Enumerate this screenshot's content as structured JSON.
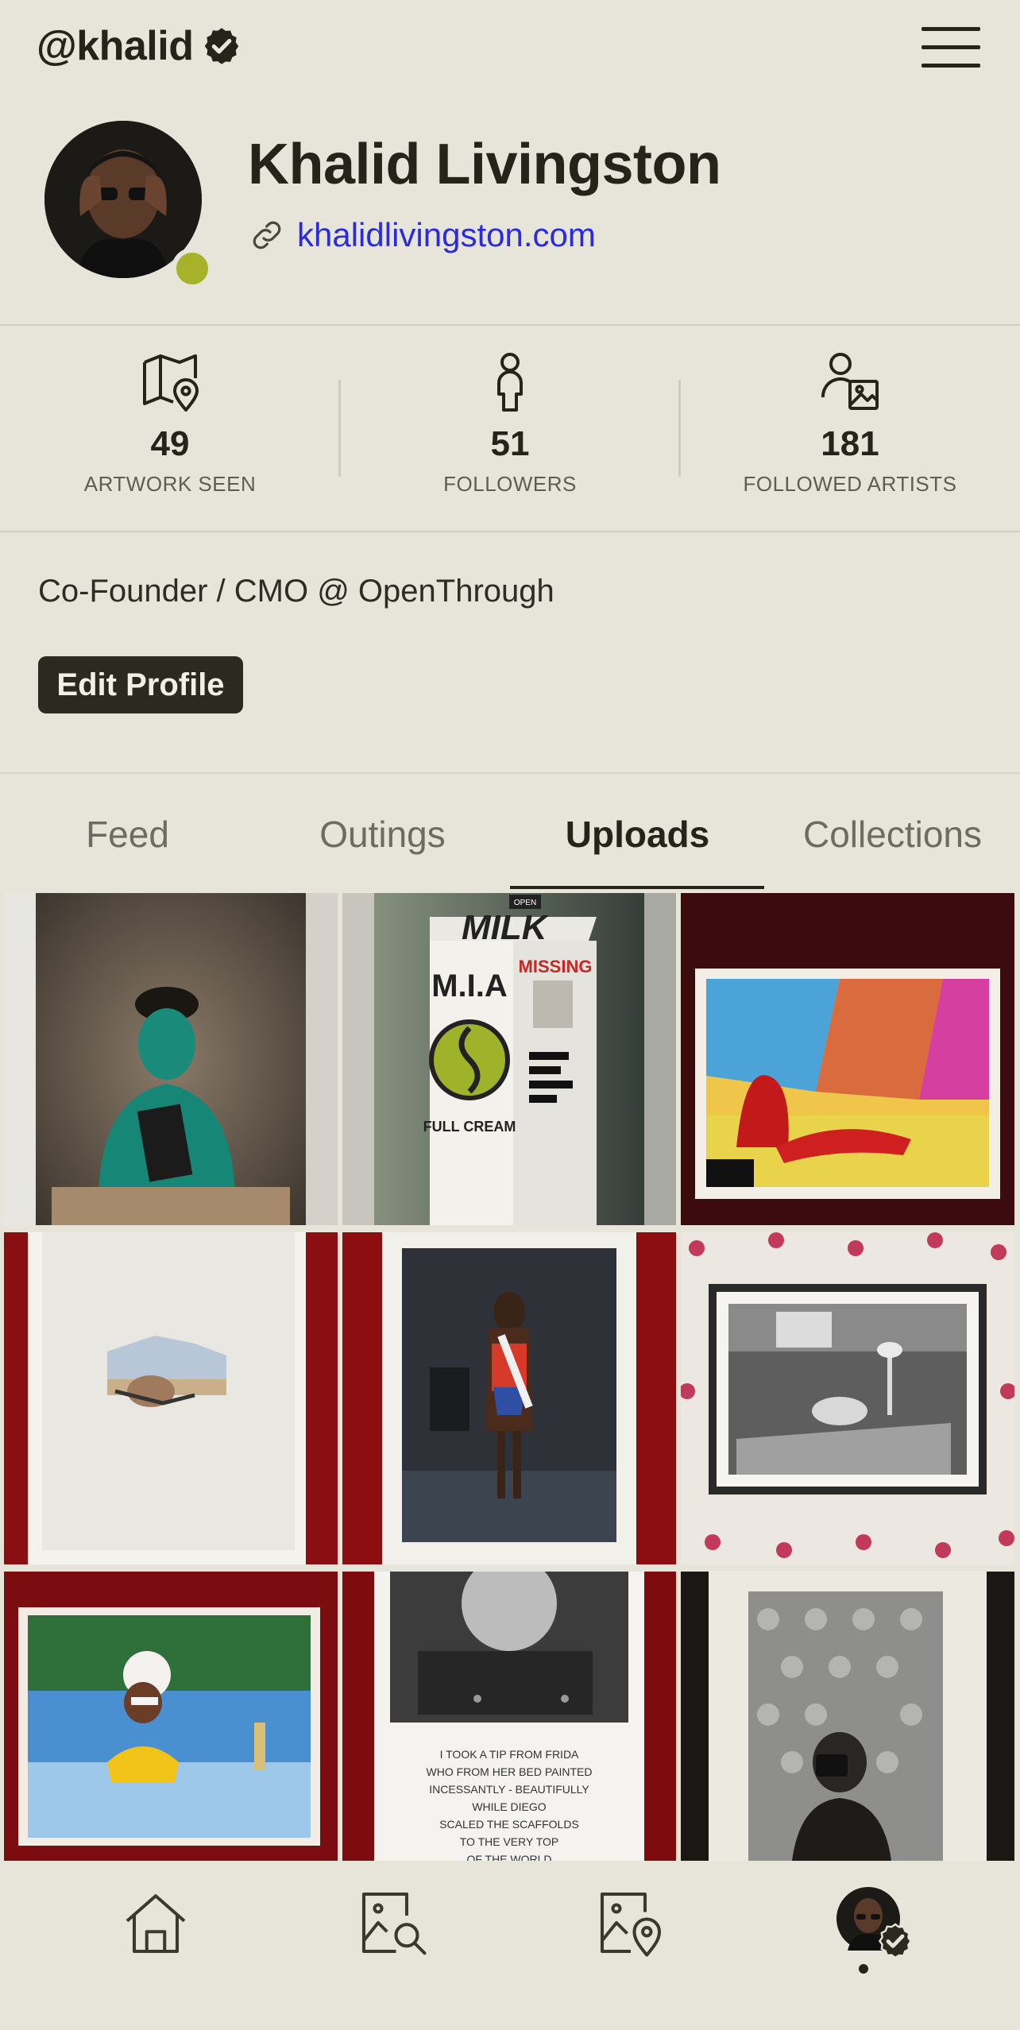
{
  "header": {
    "handle": "@khalid",
    "verified_icon": "verified-badge-icon",
    "menu_icon": "hamburger-menu-icon"
  },
  "profile": {
    "name": "Khalid Livingston",
    "website": "khalidlivingston.com",
    "link_icon": "link-icon",
    "status_color": "#a8b12a"
  },
  "stats": [
    {
      "icon": "map-pin-icon",
      "value": "49",
      "label": "ARTWORK SEEN"
    },
    {
      "icon": "person-icon",
      "value": "51",
      "label": "FOLLOWERS"
    },
    {
      "icon": "person-image-icon",
      "value": "181",
      "label": "FOLLOWED ARTISTS"
    }
  ],
  "bio": "Co-Founder / CMO @ OpenThrough",
  "edit_profile_label": "Edit Profile",
  "tabs": [
    {
      "label": "Feed",
      "active": false
    },
    {
      "label": "Outings",
      "active": false
    },
    {
      "label": "Uploads",
      "active": true
    },
    {
      "label": "Collections",
      "active": false
    }
  ],
  "uploads": [
    {
      "artwork_text": []
    },
    {
      "artwork_text": [
        "MILK",
        "M.I.A",
        "MISSING",
        "FULL CREAM",
        "OPEN"
      ]
    },
    {
      "artwork_text": []
    },
    {
      "artwork_text": []
    },
    {
      "artwork_text": []
    },
    {
      "artwork_text": []
    },
    {
      "artwork_text": []
    },
    {
      "artwork_text": [
        "I TOOK A TIP FROM FRIDA",
        "WHO FROM HER BED PAINTED",
        "INCESSANTLY - BEAUTIFULLY",
        "WHILE DIEGO",
        "SCALED THE SCAFFOLDS",
        "TO THE VERY TOP",
        "OF THE WORLD"
      ]
    },
    {
      "artwork_text": []
    }
  ],
  "bottom_nav": [
    {
      "icon": "home-icon"
    },
    {
      "icon": "search-artwork-icon"
    },
    {
      "icon": "artwork-location-icon"
    },
    {
      "icon": "profile-avatar-icon"
    }
  ],
  "colors": {
    "background": "#e7e4d9",
    "text": "#25231a",
    "link": "#2a2ae0",
    "button": "#2b2a20"
  }
}
